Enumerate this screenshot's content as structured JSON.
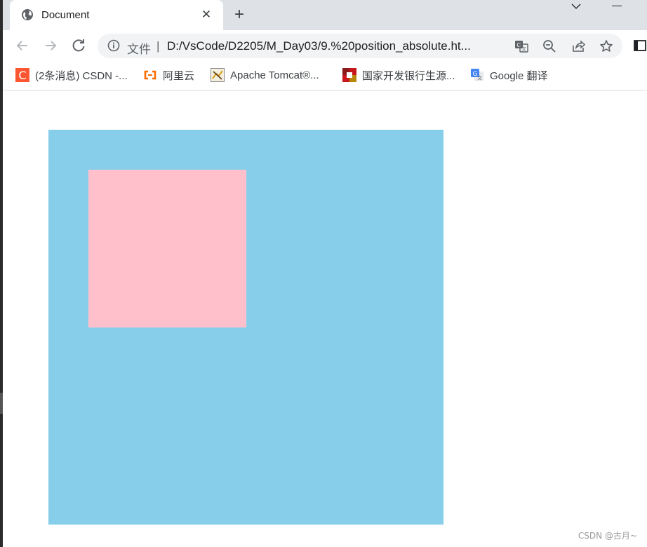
{
  "tab": {
    "title": "Document",
    "icon": "globe-icon",
    "close_label": "✕",
    "new_tab_label": "+"
  },
  "toolbar": {
    "back_icon": "arrow-left-icon",
    "forward_icon": "arrow-right-icon",
    "reload_icon": "reload-icon",
    "file_label": "文件",
    "separator": "|",
    "url": "D:/VsCode/D2205/M_Day03/9.%20position_absolute.ht...",
    "icons": [
      "translate-icon",
      "zoom-out-icon",
      "share-icon",
      "star-icon",
      "side-panel-icon"
    ]
  },
  "bookmarks": [
    {
      "label": "(2条消息) CSDN -...",
      "icon": "csdn-icon",
      "color": "#fc5531"
    },
    {
      "label": "阿里云",
      "icon": "aliyun-icon",
      "color": "#ff6a00"
    },
    {
      "label": "Apache Tomcat®...",
      "icon": "tomcat-icon",
      "color": "#d4a017"
    },
    {
      "label": "国家开发银行生源...",
      "icon": "cdb-icon",
      "color": "#c8161d"
    },
    {
      "label": "Google 翻译",
      "icon": "google-translate-icon",
      "color": "#4285f4"
    }
  ],
  "page": {
    "outer_color": "#87ceeb",
    "inner_color": "#ffc0cb",
    "watermark": "CSDN @古月~"
  }
}
